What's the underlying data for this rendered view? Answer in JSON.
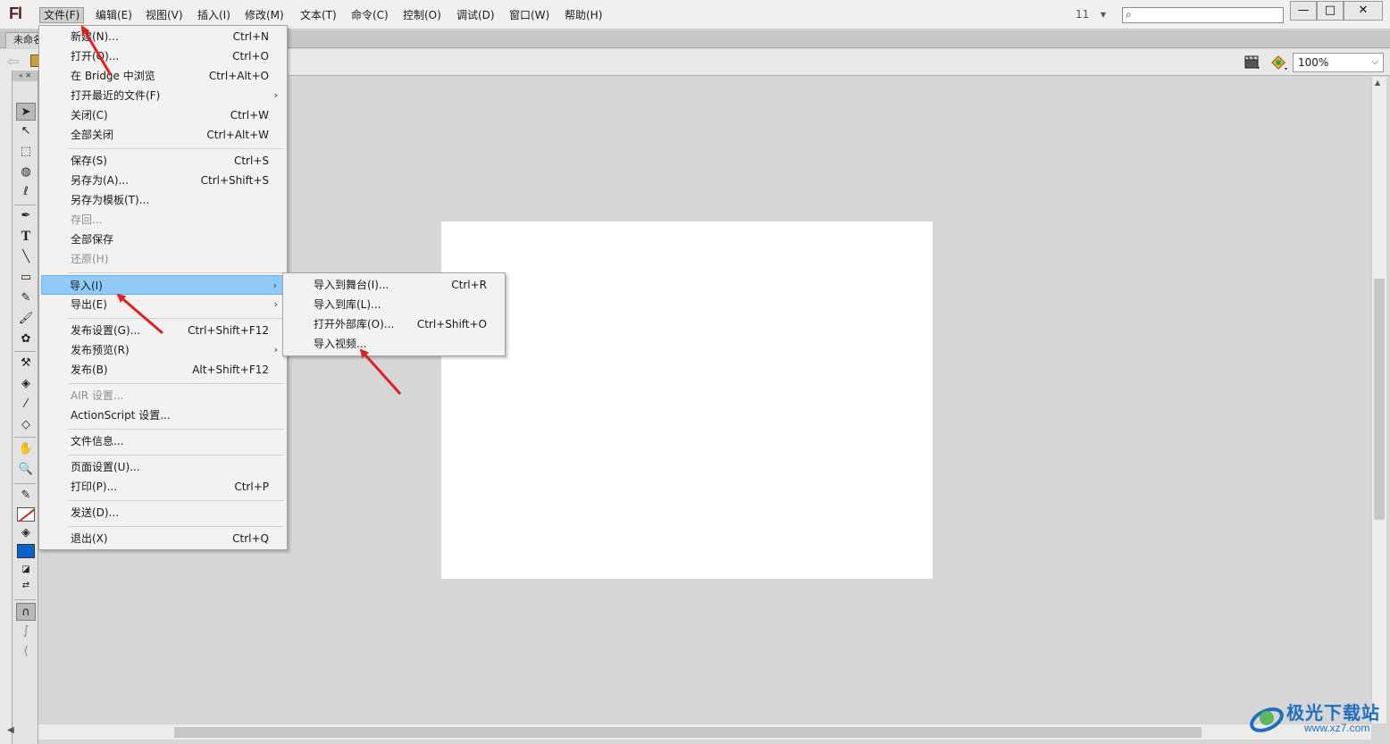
{
  "app": {
    "logo": "Fl"
  },
  "menubar": {
    "items": [
      "文件(F)",
      "编辑(E)",
      "视图(V)",
      "插入(I)",
      "修改(M)",
      "文本(T)",
      "命令(C)",
      "控制(O)",
      "调试(D)",
      "窗口(W)",
      "帮助(H)"
    ],
    "active_index": 0,
    "font_size_value": "11",
    "search_placeholder": ""
  },
  "window_controls": {
    "minimize": "—",
    "maximize": "□",
    "close": "✕"
  },
  "document_tab": {
    "label": "未命名"
  },
  "edit_bar": {
    "zoom": "100%"
  },
  "file_menu": {
    "items": [
      {
        "label": "新建(N)...",
        "shortcut": "Ctrl+N"
      },
      {
        "label": "打开(O)...",
        "shortcut": "Ctrl+O"
      },
      {
        "label": "在 Bridge 中浏览",
        "shortcut": "Ctrl+Alt+O"
      },
      {
        "label": "打开最近的文件(F)",
        "shortcut": "",
        "submenu": true
      },
      {
        "label": "关闭(C)",
        "shortcut": "Ctrl+W"
      },
      {
        "label": "全部关闭",
        "shortcut": "Ctrl+Alt+W"
      },
      {
        "label": "保存(S)",
        "shortcut": "Ctrl+S"
      },
      {
        "label": "另存为(A)...",
        "shortcut": "Ctrl+Shift+S"
      },
      {
        "label": "另存为模板(T)...",
        "shortcut": ""
      },
      {
        "label": "存回...",
        "shortcut": "",
        "disabled": true
      },
      {
        "label": "全部保存",
        "shortcut": ""
      },
      {
        "label": "还原(H)",
        "shortcut": "",
        "disabled": true
      },
      {
        "label": "导入(I)",
        "shortcut": "",
        "submenu": true,
        "highlight": true
      },
      {
        "label": "导出(E)",
        "shortcut": "",
        "submenu": true
      },
      {
        "label": "发布设置(G)...",
        "shortcut": "Ctrl+Shift+F12"
      },
      {
        "label": "发布预览(R)",
        "shortcut": "",
        "submenu": true
      },
      {
        "label": "发布(B)",
        "shortcut": "Alt+Shift+F12"
      },
      {
        "label": "AIR 设置...",
        "shortcut": "",
        "disabled": true
      },
      {
        "label": "ActionScript 设置...",
        "shortcut": ""
      },
      {
        "label": "文件信息...",
        "shortcut": ""
      },
      {
        "label": "页面设置(U)...",
        "shortcut": ""
      },
      {
        "label": "打印(P)...",
        "shortcut": "Ctrl+P"
      },
      {
        "label": "发送(D)...",
        "shortcut": ""
      },
      {
        "label": "退出(X)",
        "shortcut": "Ctrl+Q"
      }
    ]
  },
  "import_submenu": {
    "items": [
      {
        "label": "导入到舞台(I)...",
        "shortcut": "Ctrl+R"
      },
      {
        "label": "导入到库(L)...",
        "shortcut": ""
      },
      {
        "label": "打开外部库(O)...",
        "shortcut": "Ctrl+Shift+O"
      },
      {
        "label": "导入视频...",
        "shortcut": ""
      }
    ]
  },
  "tools": [
    "selection-tool",
    "subselection-tool",
    "free-transform-tool",
    "3d-rotation-tool",
    "lasso-tool",
    "pen-tool",
    "text-tool",
    "line-tool",
    "rectangle-tool",
    "pencil-tool",
    "brush-tool",
    "deco-tool",
    "bone-tool",
    "paint-bucket-tool",
    "eyedropper-tool",
    "eraser-tool",
    "hand-tool",
    "zoom-tool"
  ],
  "colors": {
    "stroke": "#ff0000-none",
    "fill": "#0a63c9",
    "menu_highlight": "#91c9f7",
    "annotation_arrow": "#e02020"
  },
  "watermark": {
    "brand": "极光下载站",
    "url": "www.xz7.com"
  }
}
